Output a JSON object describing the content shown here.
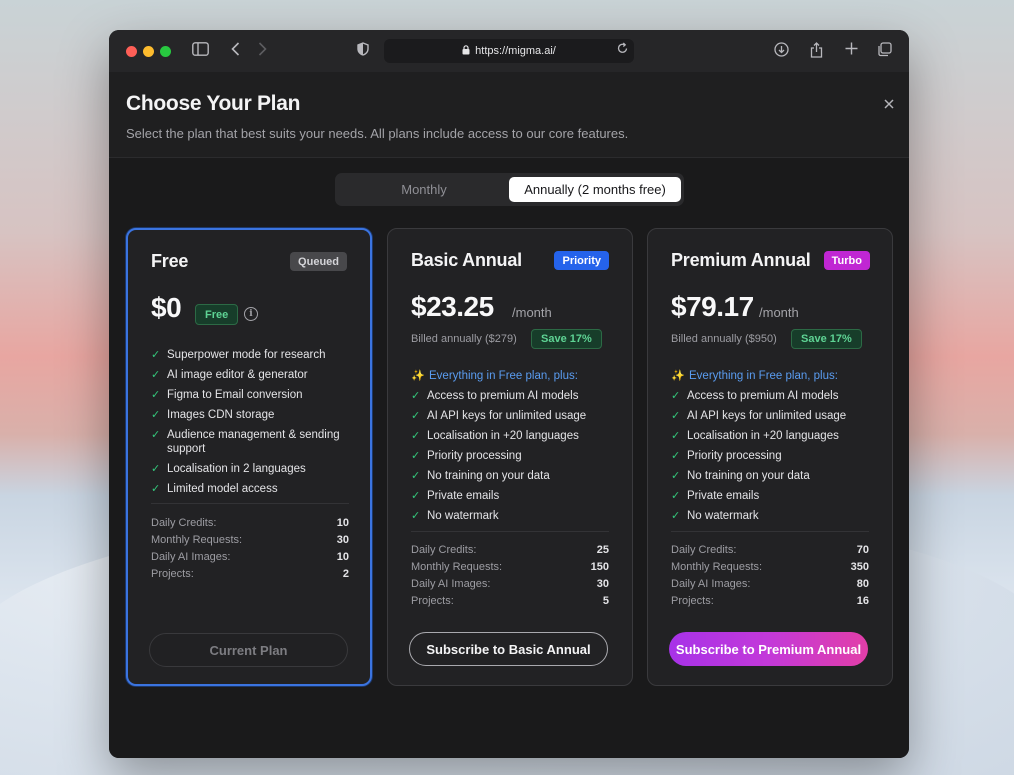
{
  "browser": {
    "url": "https://migma.ai/"
  },
  "header": {
    "title": "Choose Your Plan",
    "subtitle": "Select the plan that best suits your needs. All plans include access to our core features.",
    "close_icon": "close-icon"
  },
  "billing_toggle": {
    "options": [
      "Monthly",
      "Annually (2 months free)"
    ],
    "selected": "Annually (2 months free)"
  },
  "plans": [
    {
      "name": "Free",
      "badge": "Queued",
      "price": "$0",
      "price_pill": "Free",
      "features": [
        "Superpower mode for research",
        "AI image editor & generator",
        "Figma to Email conversion",
        "Images CDN storage",
        "Audience management & sending support",
        "Localisation in 2 languages",
        "Limited model access"
      ],
      "stats": [
        {
          "label": "Daily Credits:",
          "value": "10"
        },
        {
          "label": "Monthly Requests:",
          "value": "30"
        },
        {
          "label": "Daily AI Images:",
          "value": "10"
        },
        {
          "label": "Projects:",
          "value": "2"
        }
      ],
      "cta": "Current Plan"
    },
    {
      "name": "Basic Annual",
      "badge": "Priority",
      "price": "$23.25",
      "per": "/month",
      "billed": "Billed annually ($279)",
      "save": "Save 17%",
      "lead": "Everything in Free plan, plus:",
      "features": [
        "Access to premium AI models",
        "AI API keys for unlimited usage",
        "Localisation in +20 languages",
        "Priority processing",
        "No training on your data",
        "Private emails",
        "No watermark"
      ],
      "stats": [
        {
          "label": "Daily Credits:",
          "value": "25"
        },
        {
          "label": "Monthly Requests:",
          "value": "150"
        },
        {
          "label": "Daily AI Images:",
          "value": "30"
        },
        {
          "label": "Projects:",
          "value": "5"
        }
      ],
      "cta": "Subscribe to Basic Annual"
    },
    {
      "name": "Premium Annual",
      "badge": "Turbo",
      "price": "$79.17",
      "per": "/month",
      "billed": "Billed annually ($950)",
      "save": "Save 17%",
      "lead": "Everything in Free plan, plus:",
      "features": [
        "Access to premium AI models",
        "AI API keys for unlimited usage",
        "Localisation in +20 languages",
        "Priority processing",
        "No training on your data",
        "Private emails",
        "No watermark"
      ],
      "stats": [
        {
          "label": "Daily Credits:",
          "value": "70"
        },
        {
          "label": "Monthly Requests:",
          "value": "350"
        },
        {
          "label": "Daily AI Images:",
          "value": "80"
        },
        {
          "label": "Projects:",
          "value": "16"
        }
      ],
      "cta": "Subscribe to Premium Annual"
    }
  ],
  "colors": {
    "accent_blue": "#3b74e0",
    "priority_badge": "#2563eb",
    "turbo_badge": "#c026d3",
    "success_green": "#5ed394"
  }
}
